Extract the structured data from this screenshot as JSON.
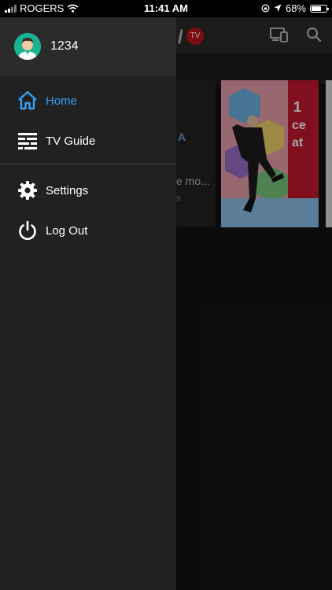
{
  "status": {
    "carrier": "ROGERS",
    "time": "11:41 AM",
    "battery": "68%",
    "battery_level": 0.68
  },
  "background": {
    "logo_badge": "TV",
    "card_title_partial": "e mo...",
    "card_meta_partial": "s",
    "poster_text": "1 ce at"
  },
  "drawer": {
    "username": "1234",
    "items": [
      {
        "label": "Home",
        "icon": "home-icon"
      },
      {
        "label": "TV Guide",
        "icon": "tv-guide-icon"
      },
      {
        "label": "Settings",
        "icon": "gear-icon"
      },
      {
        "label": "Log Out",
        "icon": "power-icon"
      }
    ]
  },
  "colors": {
    "accent": "#3aa0f0",
    "drawer_bg": "#212121",
    "header_bg": "#2b2b2b",
    "badge_red": "#c0121b"
  }
}
